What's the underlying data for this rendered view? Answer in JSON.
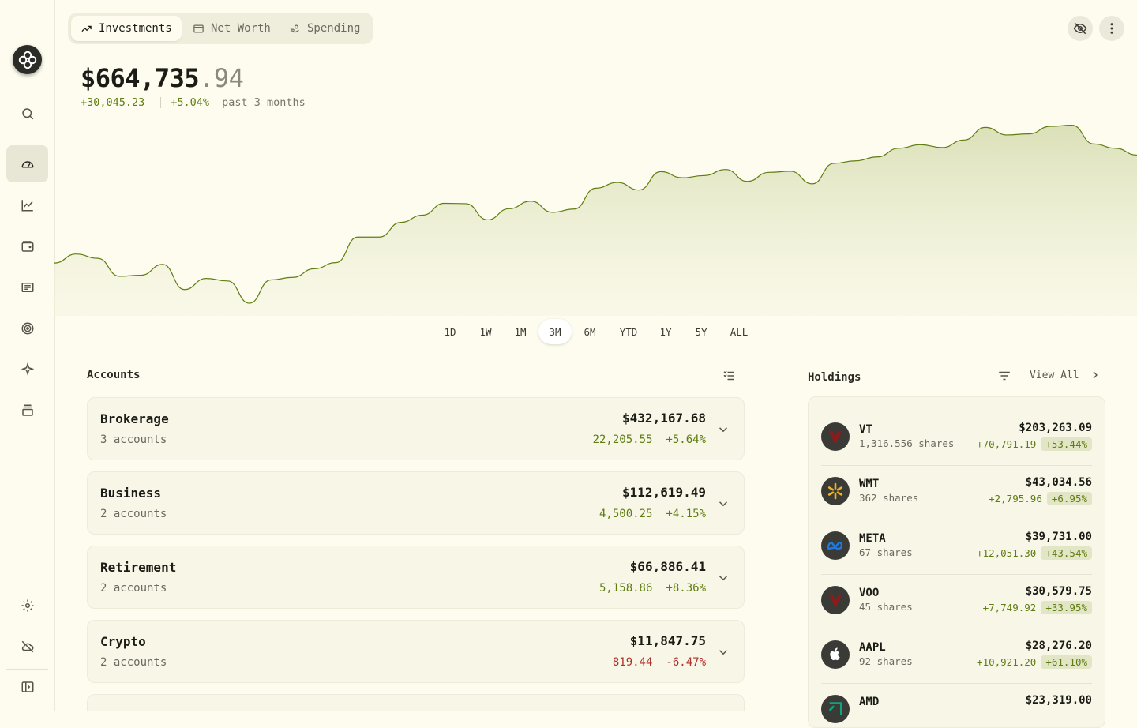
{
  "tabs": [
    {
      "label": "Investments",
      "icon": "trending-up-icon",
      "active": true
    },
    {
      "label": "Net Worth",
      "icon": "wallet-icon",
      "active": false
    },
    {
      "label": "Spending",
      "icon": "hand-coins-icon",
      "active": false
    }
  ],
  "portfolio": {
    "value_main": "$664,735",
    "value_cents": ".94",
    "change_amount": "+30,045.23",
    "change_percent": "+5.04%",
    "period_label": "past 3 months"
  },
  "chart_data": {
    "type": "area",
    "x": [
      0,
      2,
      4,
      6,
      8,
      10,
      12,
      14,
      16,
      18,
      20,
      22,
      24,
      26,
      28,
      30,
      32,
      34,
      36,
      38,
      40,
      42,
      44,
      46,
      48,
      50,
      52,
      54,
      56,
      58,
      60,
      62,
      64,
      66,
      68,
      70,
      72,
      74,
      76,
      78,
      80,
      82,
      84,
      86,
      88,
      90,
      92,
      94,
      96,
      98,
      100
    ],
    "values": [
      634690,
      637200,
      636000,
      631000,
      631300,
      634300,
      627300,
      630400,
      629700,
      623500,
      630000,
      630700,
      633100,
      634800,
      641900,
      641900,
      646000,
      648000,
      651300,
      651200,
      646700,
      649800,
      651900,
      648800,
      649700,
      655500,
      657100,
      655000,
      660100,
      658400,
      659000,
      660700,
      657400,
      659900,
      660200,
      656700,
      662400,
      663100,
      664200,
      666600,
      667600,
      666800,
      668900,
      672400,
      670300,
      670600,
      672700,
      673000,
      667800,
      666600,
      664700
    ],
    "color": "#5f7d10",
    "fill": "#e3e6c8"
  },
  "ranges": [
    "1D",
    "1W",
    "1M",
    "3M",
    "6M",
    "YTD",
    "1Y",
    "5Y",
    "ALL"
  ],
  "active_range": "3M",
  "accounts_title": "Accounts",
  "accounts": [
    {
      "name": "Brokerage",
      "sub": "3 accounts",
      "amount": "$432,167.68",
      "change": "22,205.55",
      "pct": "+5.64%",
      "positive": true
    },
    {
      "name": "Business",
      "sub": "2 accounts",
      "amount": "$112,619.49",
      "change": "4,500.25",
      "pct": "+4.15%",
      "positive": true
    },
    {
      "name": "Retirement",
      "sub": "2 accounts",
      "amount": "$66,886.41",
      "change": "5,158.86",
      "pct": "+8.36%",
      "positive": true
    },
    {
      "name": "Crypto",
      "sub": "2 accounts",
      "amount": "$11,847.75",
      "change": "819.44",
      "pct": "-6.47%",
      "positive": false
    }
  ],
  "holdings_title": "Holdings",
  "view_all": "View All",
  "holdings": [
    {
      "ticker": "VT",
      "shares": "1,316.556 shares",
      "value": "$203,263.09",
      "change": "+70,791.19",
      "pct": "+53.44%",
      "logo": "vanguard-logo-icon"
    },
    {
      "ticker": "WMT",
      "shares": "362 shares",
      "value": "$43,034.56",
      "change": "+2,795.96",
      "pct": "+6.95%",
      "logo": "walmart-logo-icon"
    },
    {
      "ticker": "META",
      "shares": "67 shares",
      "value": "$39,731.00",
      "change": "+12,051.30",
      "pct": "+43.54%",
      "logo": "meta-logo-icon"
    },
    {
      "ticker": "VOO",
      "shares": "45 shares",
      "value": "$30,579.75",
      "change": "+7,749.92",
      "pct": "+33.95%",
      "logo": "vanguard-logo-icon"
    },
    {
      "ticker": "AAPL",
      "shares": "92 shares",
      "value": "$28,276.20",
      "change": "+10,921.20",
      "pct": "+61.10%",
      "logo": "apple-logo-icon"
    },
    {
      "ticker": "AMD",
      "shares": "",
      "value": "$23,319.00",
      "change": "",
      "pct": "",
      "logo": "amd-logo-icon"
    }
  ]
}
